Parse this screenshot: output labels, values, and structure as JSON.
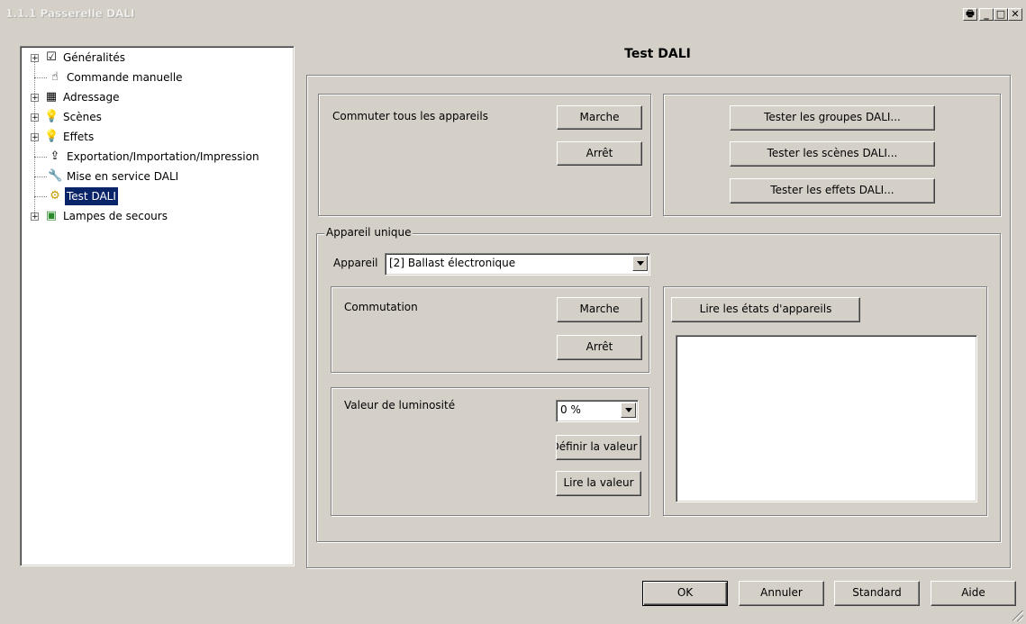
{
  "window": {
    "title": "1.1.1 Passerelle DALI"
  },
  "tree": {
    "items": [
      {
        "label": "Généralités",
        "icon": "checklist-icon",
        "expandable": true
      },
      {
        "label": "Commande manuelle",
        "icon": "hand-icon",
        "expandable": false
      },
      {
        "label": "Adressage",
        "icon": "grid-icon",
        "expandable": true
      },
      {
        "label": "Scènes",
        "icon": "bulb-icon",
        "expandable": true
      },
      {
        "label": "Effets",
        "icon": "bulb-icon",
        "expandable": true
      },
      {
        "label": "Exportation/Importation/Impression",
        "icon": "export-icon",
        "expandable": false
      },
      {
        "label": "Mise en service DALI",
        "icon": "wrench-icon",
        "expandable": false
      },
      {
        "label": "Test DALI",
        "icon": "gear-icon",
        "expandable": false,
        "selected": true
      },
      {
        "label": "Lampes de secours",
        "icon": "emergency-lamp-icon",
        "expandable": true
      }
    ]
  },
  "page": {
    "title": "Test DALI"
  },
  "all_devices": {
    "label": "Commuter tous les appareils",
    "on_label": "Marche",
    "off_label": "Arrêt"
  },
  "tests": {
    "groups_label": "Tester les groupes DALI...",
    "scenes_label": "Tester les scènes DALI...",
    "effects_label": "Tester les effets DALI..."
  },
  "single_device": {
    "legend": "Appareil unique",
    "device_label": "Appareil",
    "device_value": "[2] Ballast électronique",
    "switching": {
      "label": "Commutation",
      "on_label": "Marche",
      "off_label": "Arrêt"
    },
    "brightness": {
      "label": "Valeur de luminosité",
      "value": "0 %",
      "set_label": "Définir la valeur",
      "read_label": "Lire la valeur"
    },
    "read_states_label": "Lire les états d'appareils"
  },
  "footer": {
    "ok_label": "OK",
    "cancel_label": "Annuler",
    "standard_label": "Standard",
    "help_label": "Aide"
  }
}
